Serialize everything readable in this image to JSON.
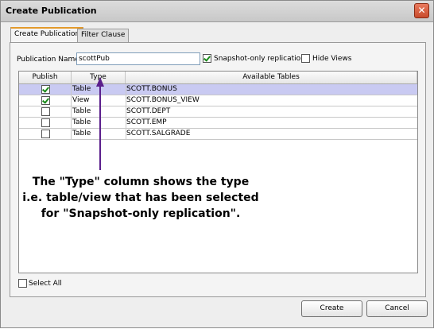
{
  "window": {
    "title": "Create Publication",
    "close_glyph": "✕"
  },
  "tabs": [
    {
      "label": "Create Publication",
      "active": true
    },
    {
      "label": "Filter Clause",
      "active": false
    }
  ],
  "form": {
    "publication_name_label": "Publication Name",
    "publication_name_value": "scottPub",
    "snapshot_only_label": "Snapshot-only replication",
    "snapshot_only_checked": true,
    "hide_views_label": "Hide Views",
    "hide_views_checked": false
  },
  "table": {
    "columns": [
      "Publish",
      "Type",
      "Available Tables"
    ],
    "rows": [
      {
        "publish": true,
        "type": "Table",
        "name": "SCOTT.BONUS",
        "selected": true
      },
      {
        "publish": true,
        "type": "View",
        "name": "SCOTT.BONUS_VIEW",
        "selected": false
      },
      {
        "publish": false,
        "type": "Table",
        "name": "SCOTT.DEPT",
        "selected": false
      },
      {
        "publish": false,
        "type": "Table",
        "name": "SCOTT.EMP",
        "selected": false
      },
      {
        "publish": false,
        "type": "Table",
        "name": "SCOTT.SALGRADE",
        "selected": false
      }
    ]
  },
  "select_all_label": "Select All",
  "annotation": {
    "line1": "The \"Type\" column shows the type",
    "line2": "i.e. table/view that has been selected",
    "line3": "for \"Snapshot-only replication\".",
    "arrow_color": "#5b1f8c"
  },
  "buttons": {
    "create": "Create",
    "cancel": "Cancel"
  }
}
